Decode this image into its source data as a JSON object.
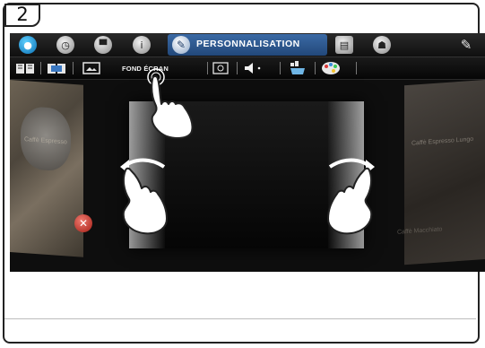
{
  "step": {
    "number": "2"
  },
  "topbar": {
    "icons": [
      "water-drop-icon",
      "clock-icon",
      "cup-icon",
      "info-icon"
    ],
    "active_tab_label": "PERSONNALISATION",
    "active_tab_icon": "pencil-icon",
    "right_icons": [
      "display-icon",
      "user-icon",
      "wrench-icon"
    ]
  },
  "subbar": {
    "items": [
      {
        "name": "book-icon"
      },
      {
        "name": "book-image-icon"
      },
      {
        "name": "picture-icon"
      },
      {
        "name": "fond-ecran",
        "label": "FOND ÉCRAN"
      },
      {
        "name": "cup-settings-icon"
      },
      {
        "name": "speaker-icon"
      },
      {
        "name": "coffee-cup-icon"
      },
      {
        "name": "palette-icon"
      }
    ]
  },
  "gallery": {
    "left_label": "Caffè Espresso",
    "right_label": "Caffè Espresso Lungo",
    "right_label_lower": "Caffè Macchiato",
    "delete_mark": "✕"
  },
  "colors": {
    "accent": "#2f5d96",
    "screen_bg": "#141414",
    "delete": "#c0261b"
  }
}
